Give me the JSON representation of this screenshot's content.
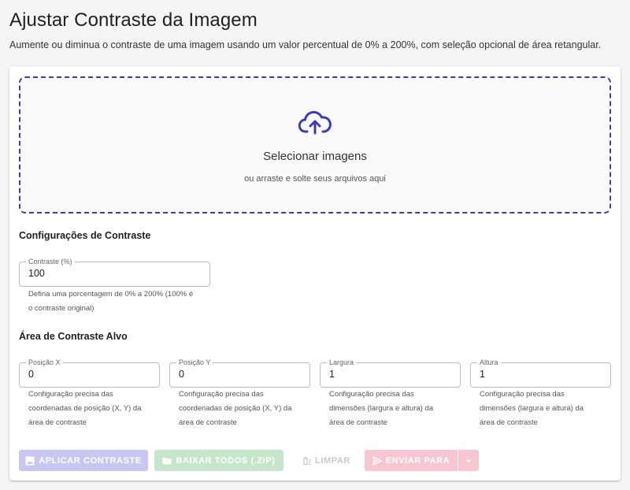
{
  "header": {
    "title": "Ajustar Contraste da Imagem",
    "subtitle": "Aumente ou diminua o contraste de uma imagem usando um valor percentual de 0% a 200%, com seleção opcional de área retangular."
  },
  "dropzone": {
    "title": "Selecionar imagens",
    "subtitle": "ou arraste e solte seus arquivos aqui",
    "icon": "cloud-upload-icon",
    "accent_color": "#3f3ab8"
  },
  "contrast_settings": {
    "title": "Configurações de Contraste",
    "field_label": "Contraste (%)",
    "value": "100",
    "helper_line1": "Defina uma porcentagem de 0% a 200% (100% é",
    "helper_line2": "o contraste original)"
  },
  "target_area": {
    "title": "Área de Contraste Alvo",
    "fields": [
      {
        "label": "Posição X",
        "value": "0",
        "helper1": "Configuração precisa das",
        "helper2": "coordenadas de posição (X, Y) da",
        "helper3": "área de contraste"
      },
      {
        "label": "Posição Y",
        "value": "0",
        "helper1": "Configuração precisa das",
        "helper2": "coordenadas de posição (X, Y) da",
        "helper3": "área de contraste"
      },
      {
        "label": "Largura",
        "value": "1",
        "helper1": "Configuração precisa das",
        "helper2": "dimensões (largura e altura) da",
        "helper3": "área de contraste"
      },
      {
        "label": "Altura",
        "value": "1",
        "helper1": "Configuração precisa das",
        "helper2": "dimensões (largura e altura) da",
        "helper3": "área de contraste"
      }
    ]
  },
  "actions": {
    "apply_label": "APLICAR CONTRASTE",
    "download_label": "BAIXAR TODOS (.ZIP)",
    "clear_label": "LIMPAR",
    "send_label": "ENVIAR PARA",
    "colors": {
      "apply": "#c9c7f2",
      "download": "#c6e6cb",
      "send": "#f7c6d4"
    }
  }
}
